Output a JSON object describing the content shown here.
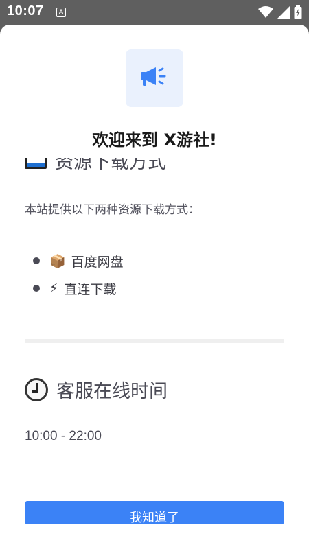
{
  "status_bar": {
    "time": "10:07",
    "a_badge": "A",
    "icons": [
      "wifi-icon",
      "signal-icon",
      "battery-icon"
    ]
  },
  "dialog": {
    "title": "欢迎来到 X游社!",
    "logo_icon": "megaphone-icon",
    "accent_color": "#3b82f6",
    "sections": {
      "download": {
        "heading": "资源下载方式",
        "icon": "calendar-icon",
        "paragraph": "本站提供以下两种资源下载方式：",
        "items": [
          {
            "emoji": "📦",
            "label": "百度网盘"
          },
          {
            "emoji": "⚡",
            "label": "直连下载"
          }
        ]
      },
      "service": {
        "heading": "客服在线时间",
        "icon": "clock-icon",
        "hours": "10:00 - 22:00"
      }
    },
    "button_label": "我知道了"
  }
}
